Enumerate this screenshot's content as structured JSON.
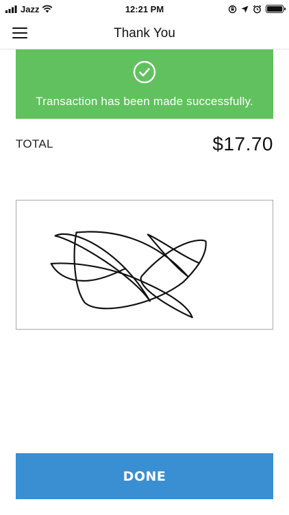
{
  "status_bar": {
    "carrier": "Jazz",
    "time": "12:21 PM",
    "icons": [
      "signal-icon",
      "wifi-icon",
      "orientation-lock-icon",
      "location-icon",
      "alarm-icon",
      "battery-icon"
    ]
  },
  "nav": {
    "title": "Thank You",
    "menu_icon": "hamburger-menu-icon"
  },
  "banner": {
    "icon": "check-circle-icon",
    "message": "Transaction has been made successfully.",
    "color": "#61c15e"
  },
  "total": {
    "label": "TOTAL",
    "amount": "$17.70"
  },
  "signature": {
    "name": "signature-pad"
  },
  "actions": {
    "done_label": "DONE",
    "done_color": "#3a8fd3"
  }
}
